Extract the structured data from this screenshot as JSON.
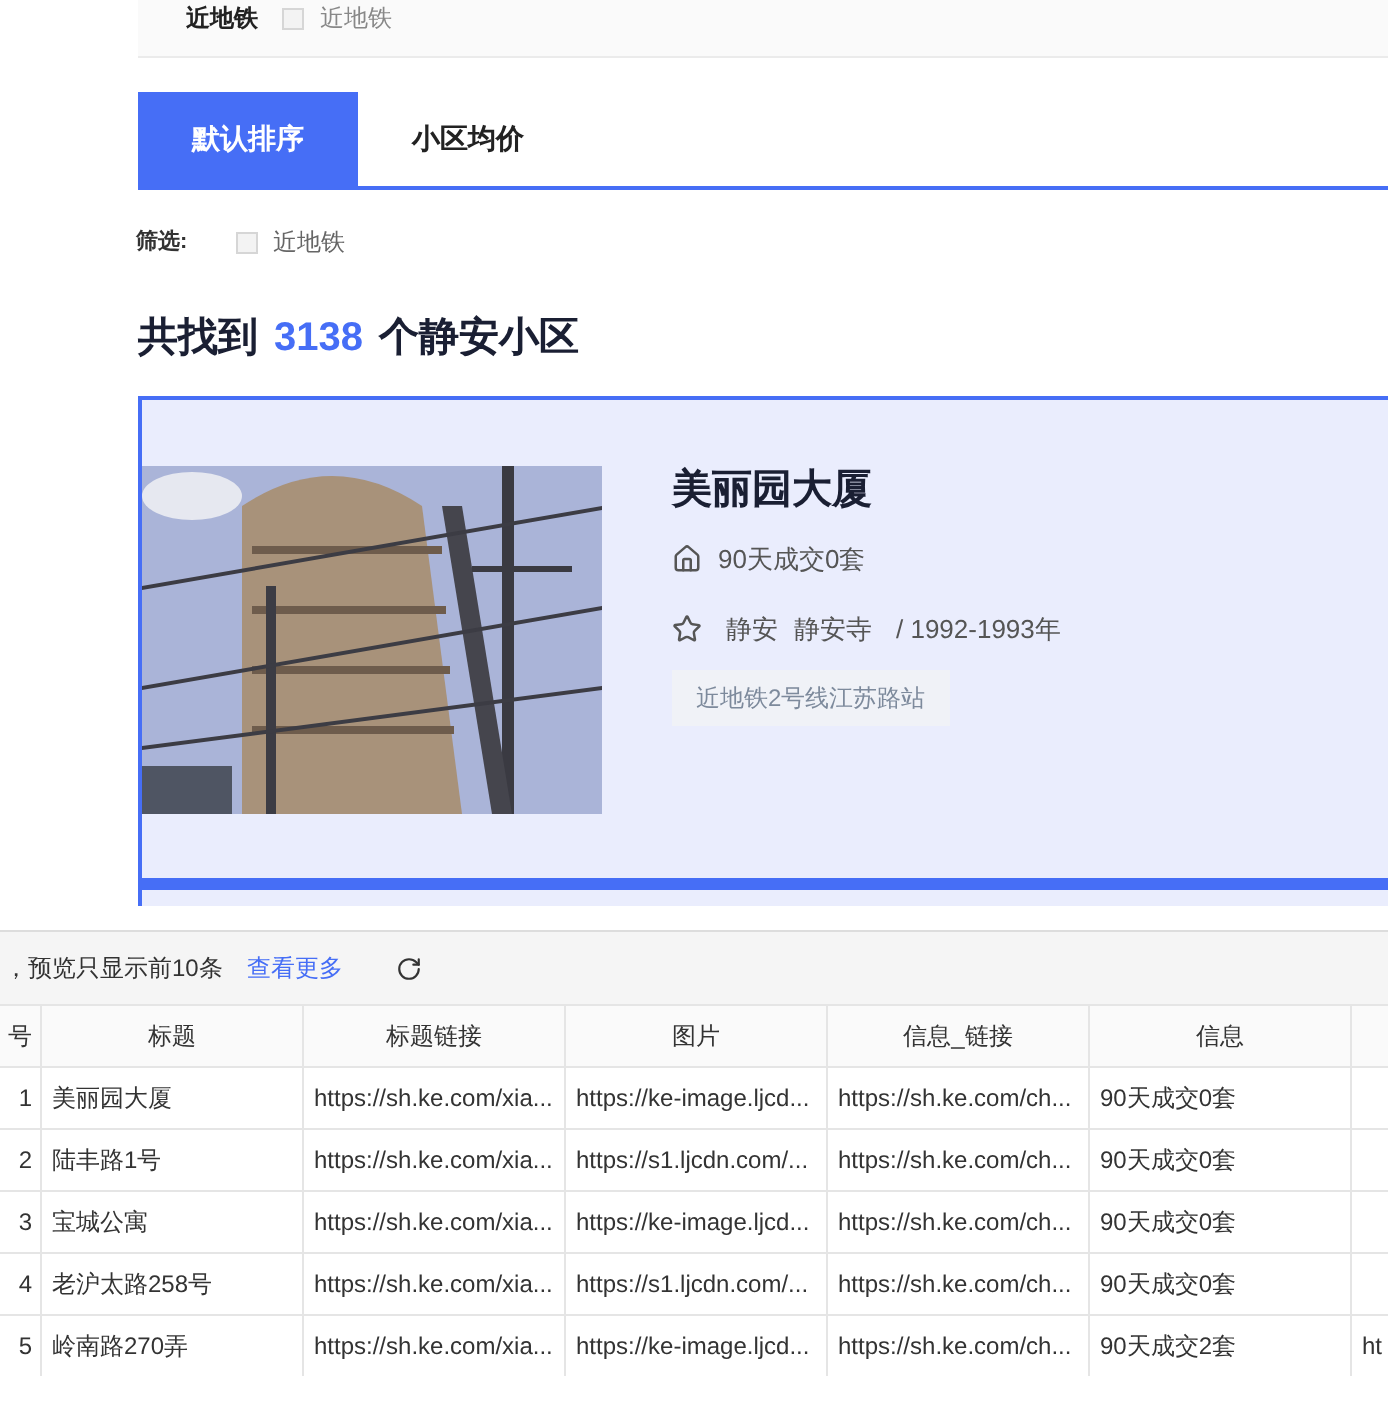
{
  "top_filter": {
    "label": "近地铁",
    "option": {
      "label": "近地铁",
      "checked": false
    }
  },
  "tabs": [
    {
      "label": "默认排序",
      "selected": true
    },
    {
      "label": "小区均价",
      "selected": false
    }
  ],
  "filter": {
    "label": "筛选:",
    "option": {
      "label": "近地铁",
      "checked": false
    }
  },
  "headline": {
    "prefix": "共找到",
    "count": "3138",
    "suffix": "个静安小区"
  },
  "listing": {
    "selected": true,
    "title": "美丽园大厦",
    "deals": "90天成交0套",
    "district": "静安",
    "area": "静安寺",
    "years": "/ 1992-1993年",
    "tag": "近地铁2号线江苏路站"
  },
  "preview": {
    "notice": "，预览只显示前10条",
    "more_link": "查看更多",
    "columns": [
      "号",
      "标题",
      "标题链接",
      "图片",
      "信息_链接",
      "信息",
      ""
    ],
    "rows": [
      [
        "1",
        "美丽园大厦",
        "https://sh.ke.com/xia...",
        "https://ke-image.ljcd...",
        "https://sh.ke.com/ch...",
        "90天成交0套",
        ""
      ],
      [
        "2",
        "陆丰路1号",
        "https://sh.ke.com/xia...",
        "https://s1.ljcdn.com/...",
        "https://sh.ke.com/ch...",
        "90天成交0套",
        ""
      ],
      [
        "3",
        "宝城公寓",
        "https://sh.ke.com/xia...",
        "https://ke-image.ljcd...",
        "https://sh.ke.com/ch...",
        "90天成交0套",
        ""
      ],
      [
        "4",
        "老沪太路258号",
        "https://sh.ke.com/xia...",
        "https://s1.ljcdn.com/...",
        "https://sh.ke.com/ch...",
        "90天成交0套",
        ""
      ],
      [
        "5",
        "岭南路270弄",
        "https://sh.ke.com/xia...",
        "https://ke-image.ljcd...",
        "https://sh.ke.com/ch...",
        "90天成交2套",
        "ht"
      ]
    ]
  }
}
